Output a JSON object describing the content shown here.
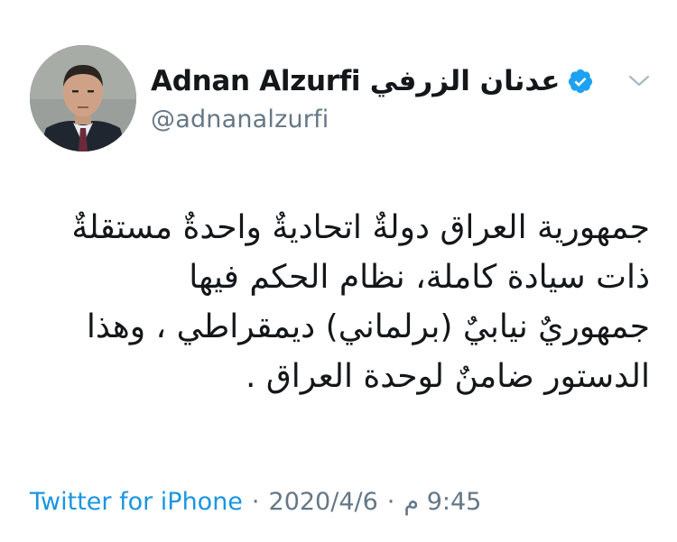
{
  "user": {
    "display_name": "Adnan Alzurfi عدنان الزرفي",
    "handle": "@adnanalzurfi",
    "verified": true
  },
  "tweet": {
    "lines": [
      "جمهورية العراق دولةٌ اتحاديةٌ واحدةٌ مستقلةٌ",
      "ذات سيادة كاملة، نظام الحكم فيها",
      "جمهوريٌ نيابيٌ (برلماني) ديمقراطي ، وهذا",
      "الدستور ضامنٌ لوحدة العراق ."
    ]
  },
  "footer": {
    "source": "Twitter for iPhone",
    "separator": "·",
    "date": "2020/4/6",
    "time": "9:45 م"
  },
  "icons": {
    "verified": "verified-badge-icon",
    "caret": "chevron-down-icon"
  },
  "colors": {
    "text": "#14171a",
    "secondary": "#657786",
    "link": "#1b95e0",
    "verified": "#1da1f2"
  }
}
